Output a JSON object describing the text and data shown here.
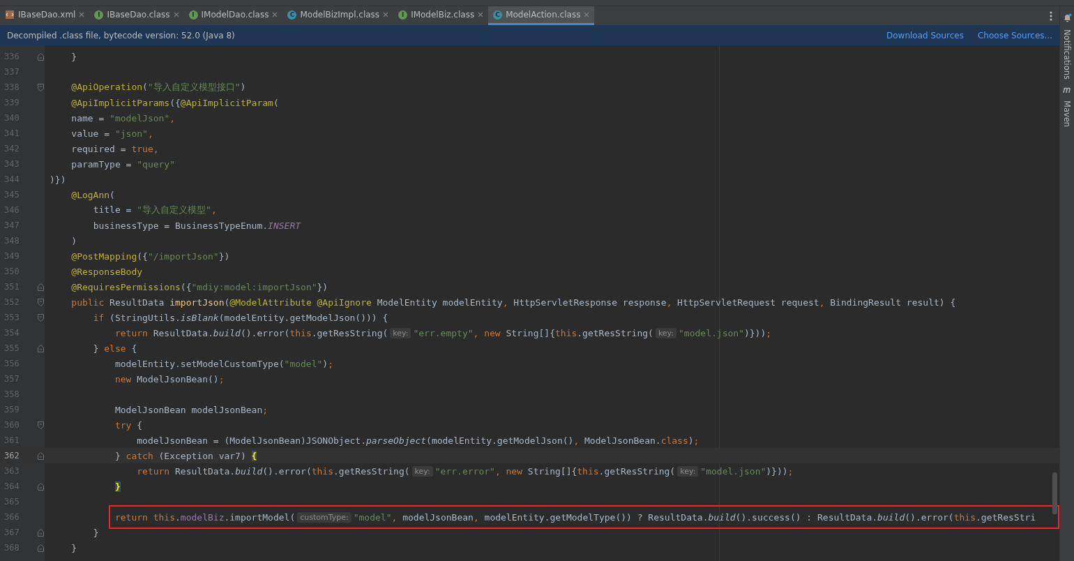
{
  "tabs": [
    {
      "label": "IBaseDao.xml",
      "kind": "xml",
      "selected": false
    },
    {
      "label": "IBaseDao.class",
      "kind": "interface",
      "badge": "I",
      "selected": false
    },
    {
      "label": "IModelDao.class",
      "kind": "interface",
      "badge": "I",
      "selected": false
    },
    {
      "label": "ModelBizImpl.class",
      "kind": "class",
      "badge": "C",
      "selected": false
    },
    {
      "label": "IModelBiz.class",
      "kind": "interface",
      "badge": "I",
      "selected": false
    },
    {
      "label": "ModelAction.class",
      "kind": "class",
      "badge": "C",
      "selected": true
    }
  ],
  "banner": {
    "text": "Decompiled .class file, bytecode version: 52.0 (Java 8)",
    "links": [
      "Download Sources",
      "Choose Sources..."
    ]
  },
  "side_tools": [
    "Notifications",
    "Maven"
  ],
  "lines": [
    {
      "number": "336",
      "fold_end": true,
      "tokens": [
        {
          "kind": "plain",
          "text": "    }"
        }
      ]
    },
    {
      "number": "337"
    },
    {
      "number": "338",
      "fold_start": true,
      "tokens": [
        {
          "kind": "annotation",
          "text": "    @ApiOperation"
        },
        {
          "kind": "plain",
          "text": "("
        },
        {
          "kind": "string",
          "text": "\"导入自定义模型接口\""
        },
        {
          "kind": "plain",
          "text": ")"
        }
      ]
    },
    {
      "number": "339",
      "tokens": [
        {
          "kind": "annotation",
          "text": "    @ApiImplicitParams"
        },
        {
          "kind": "plain",
          "text": "({"
        },
        {
          "kind": "annotation",
          "text": "@ApiImplicitParam"
        },
        {
          "kind": "plain",
          "text": "("
        }
      ]
    },
    {
      "number": "340",
      "tokens": [
        {
          "kind": "plain",
          "text": "    name = "
        },
        {
          "kind": "string",
          "text": "\"modelJson\""
        },
        {
          "kind": "keyword",
          "text": ","
        }
      ]
    },
    {
      "number": "341",
      "tokens": [
        {
          "kind": "plain",
          "text": "    value = "
        },
        {
          "kind": "string",
          "text": "\"json\""
        },
        {
          "kind": "keyword",
          "text": ","
        }
      ]
    },
    {
      "number": "342",
      "tokens": [
        {
          "kind": "plain",
          "text": "    required = "
        },
        {
          "kind": "keyword",
          "text": "true,"
        }
      ]
    },
    {
      "number": "343",
      "tokens": [
        {
          "kind": "plain",
          "text": "    paramType = "
        },
        {
          "kind": "string",
          "text": "\"query\""
        }
      ]
    },
    {
      "number": "344",
      "tokens": [
        {
          "kind": "plain",
          "text": ")})"
        }
      ]
    },
    {
      "number": "345",
      "tokens": [
        {
          "kind": "annotation",
          "text": "    @LogAnn"
        },
        {
          "kind": "plain",
          "text": "("
        }
      ]
    },
    {
      "number": "346",
      "tokens": [
        {
          "kind": "plain",
          "text": "        title = "
        },
        {
          "kind": "string",
          "text": "\"导入自定义模型\""
        },
        {
          "kind": "keyword",
          "text": ","
        }
      ]
    },
    {
      "number": "347",
      "tokens": [
        {
          "kind": "plain",
          "text": "        businessType = BusinessTypeEnum."
        },
        {
          "kind": "constant",
          "text": "INSERT"
        }
      ]
    },
    {
      "number": "348",
      "tokens": [
        {
          "kind": "plain",
          "text": "    )"
        }
      ]
    },
    {
      "number": "349",
      "tokens": [
        {
          "kind": "annotation",
          "text": "    @PostMapping"
        },
        {
          "kind": "plain",
          "text": "({"
        },
        {
          "kind": "string",
          "text": "\"/importJson\""
        },
        {
          "kind": "plain",
          "text": "})"
        }
      ]
    },
    {
      "number": "350",
      "tokens": [
        {
          "kind": "annotation",
          "text": "    @ResponseBody"
        }
      ]
    },
    {
      "number": "351",
      "fold_end": true,
      "tokens": [
        {
          "kind": "annotation",
          "text": "    @RequiresPermissions"
        },
        {
          "kind": "plain",
          "text": "({"
        },
        {
          "kind": "string",
          "text": "\"mdiy:model:importJson\""
        },
        {
          "kind": "plain",
          "text": "})"
        }
      ]
    },
    {
      "number": "352",
      "fold_start": true,
      "tokens": [
        {
          "kind": "keyword",
          "text": "    public "
        },
        {
          "kind": "plain",
          "text": "ResultData "
        },
        {
          "kind": "method",
          "text": "importJson"
        },
        {
          "kind": "plain",
          "text": "("
        },
        {
          "kind": "annotation",
          "text": "@ModelAttribute @ApiIgnore"
        },
        {
          "kind": "plain",
          "text": " ModelEntity modelEntity"
        },
        {
          "kind": "keyword",
          "text": ","
        },
        {
          "kind": "plain",
          "text": " HttpServletResponse response"
        },
        {
          "kind": "keyword",
          "text": ","
        },
        {
          "kind": "plain",
          "text": " HttpServletRequest request"
        },
        {
          "kind": "keyword",
          "text": ","
        },
        {
          "kind": "plain",
          "text": " BindingResult result) {"
        }
      ]
    },
    {
      "number": "353",
      "fold_start": true,
      "tokens": [
        {
          "kind": "keyword",
          "text": "        if"
        },
        {
          "kind": "plain",
          "text": " (StringUtils."
        },
        {
          "kind": "static",
          "text": "isBlank"
        },
        {
          "kind": "plain",
          "text": "(modelEntity.getModelJson())) {"
        }
      ]
    },
    {
      "number": "354",
      "tokens": [
        {
          "kind": "keyword",
          "text": "            return"
        },
        {
          "kind": "plain",
          "text": " ResultData."
        },
        {
          "kind": "static",
          "text": "build"
        },
        {
          "kind": "plain",
          "text": "().error("
        },
        {
          "kind": "keyword",
          "text": "this"
        },
        {
          "kind": "plain",
          "text": ".getResString("
        },
        {
          "kind": "hint",
          "text": "key:"
        },
        {
          "kind": "string",
          "text": "\"err.empty\""
        },
        {
          "kind": "keyword",
          "text": ", new"
        },
        {
          "kind": "plain",
          "text": " String[]{"
        },
        {
          "kind": "keyword",
          "text": "this"
        },
        {
          "kind": "plain",
          "text": ".getResString("
        },
        {
          "kind": "hint",
          "text": "key:"
        },
        {
          "kind": "string",
          "text": "\"model.json\""
        },
        {
          "kind": "plain",
          "text": ")}))"
        },
        {
          "kind": "keyword",
          "text": ";"
        }
      ]
    },
    {
      "number": "355",
      "fold_end": true,
      "tokens": [
        {
          "kind": "plain",
          "text": "        } "
        },
        {
          "kind": "keyword",
          "text": "else"
        },
        {
          "kind": "plain",
          "text": " {"
        }
      ]
    },
    {
      "number": "356",
      "tokens": [
        {
          "kind": "plain",
          "text": "            modelEntity.setModelCustomType("
        },
        {
          "kind": "string",
          "text": "\"model\""
        },
        {
          "kind": "plain",
          "text": ")"
        },
        {
          "kind": "keyword",
          "text": ";"
        }
      ]
    },
    {
      "number": "357",
      "tokens": [
        {
          "kind": "keyword",
          "text": "            new"
        },
        {
          "kind": "plain",
          "text": " ModelJsonBean()"
        },
        {
          "kind": "keyword",
          "text": ";"
        }
      ]
    },
    {
      "number": "358"
    },
    {
      "number": "359",
      "tokens": [
        {
          "kind": "plain",
          "text": "            ModelJsonBean modelJsonBean"
        },
        {
          "kind": "keyword",
          "text": ";"
        }
      ]
    },
    {
      "number": "360",
      "fold_start": true,
      "tokens": [
        {
          "kind": "keyword",
          "text": "            try"
        },
        {
          "kind": "plain",
          "text": " {"
        }
      ]
    },
    {
      "number": "361",
      "tokens": [
        {
          "kind": "plain",
          "text": "                modelJsonBean = (ModelJsonBean)JSONObject."
        },
        {
          "kind": "static",
          "text": "parseObject"
        },
        {
          "kind": "plain",
          "text": "(modelEntity.getModelJson()"
        },
        {
          "kind": "keyword",
          "text": ","
        },
        {
          "kind": "plain",
          "text": " ModelJsonBean."
        },
        {
          "kind": "keyword",
          "text": "class"
        },
        {
          "kind": "plain",
          "text": ")"
        },
        {
          "kind": "keyword",
          "text": ";"
        }
      ]
    },
    {
      "number": "362",
      "fold_end": true,
      "current": true,
      "tokens": [
        {
          "kind": "plain",
          "text": "            } "
        },
        {
          "kind": "keyword",
          "text": "catch"
        },
        {
          "kind": "plain",
          "text": " (Exception var7) "
        },
        {
          "kind": "brace_match",
          "text": "{"
        }
      ]
    },
    {
      "number": "363",
      "tokens": [
        {
          "kind": "keyword",
          "text": "                return"
        },
        {
          "kind": "plain",
          "text": " ResultData."
        },
        {
          "kind": "static",
          "text": "build"
        },
        {
          "kind": "plain",
          "text": "().error("
        },
        {
          "kind": "keyword",
          "text": "this"
        },
        {
          "kind": "plain",
          "text": ".getResString("
        },
        {
          "kind": "hint",
          "text": "key:"
        },
        {
          "kind": "string",
          "text": "\"err.error\""
        },
        {
          "kind": "keyword",
          "text": ", new"
        },
        {
          "kind": "plain",
          "text": " String[]{"
        },
        {
          "kind": "keyword",
          "text": "this"
        },
        {
          "kind": "plain",
          "text": ".getResString("
        },
        {
          "kind": "hint",
          "text": "key:"
        },
        {
          "kind": "string",
          "text": "\"model.json\""
        },
        {
          "kind": "plain",
          "text": ")}))"
        },
        {
          "kind": "keyword",
          "text": ";"
        }
      ]
    },
    {
      "number": "364",
      "fold_end": true,
      "tokens": [
        {
          "kind": "brace_match",
          "text": "            }"
        }
      ]
    },
    {
      "number": "365"
    },
    {
      "number": "366",
      "boxed": true,
      "tokens": [
        {
          "kind": "keyword",
          "text": "            return this"
        },
        {
          "kind": "plain",
          "text": "."
        },
        {
          "kind": "field",
          "text": "modelBiz"
        },
        {
          "kind": "plain",
          "text": ".importModel("
        },
        {
          "kind": "hint",
          "text": "customType:"
        },
        {
          "kind": "string",
          "text": "\"model\""
        },
        {
          "kind": "keyword",
          "text": ","
        },
        {
          "kind": "plain",
          "text": " modelJsonBean"
        },
        {
          "kind": "keyword",
          "text": ","
        },
        {
          "kind": "plain",
          "text": " modelEntity.getModelType()) ? ResultData."
        },
        {
          "kind": "static",
          "text": "build"
        },
        {
          "kind": "plain",
          "text": "().success() : ResultData."
        },
        {
          "kind": "static",
          "text": "build"
        },
        {
          "kind": "plain",
          "text": "().error("
        },
        {
          "kind": "keyword",
          "text": "this"
        },
        {
          "kind": "plain",
          "text": ".getResStri"
        }
      ]
    },
    {
      "number": "367",
      "fold_end": true,
      "tokens": [
        {
          "kind": "plain",
          "text": "        }"
        }
      ]
    },
    {
      "number": "368",
      "fold_end": true,
      "tokens": [
        {
          "kind": "plain",
          "text": "    }"
        }
      ]
    }
  ]
}
